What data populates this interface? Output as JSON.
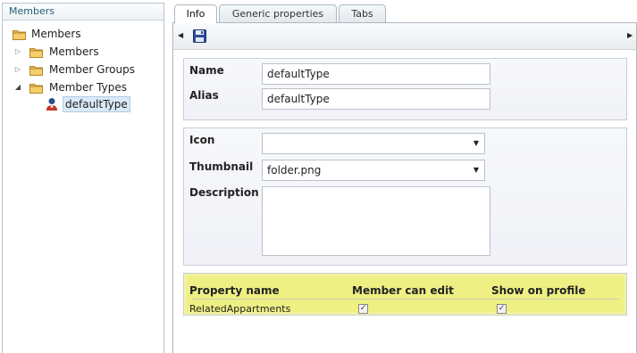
{
  "tree": {
    "header": "Members",
    "nodes": [
      {
        "label": "Members",
        "icon": "folder-icon"
      },
      {
        "label": "Members",
        "icon": "folder-icon",
        "expander": "collapsed"
      },
      {
        "label": "Member Groups",
        "icon": "folder-icon",
        "expander": "collapsed"
      },
      {
        "label": "Member Types",
        "icon": "folder-icon",
        "expander": "expanded"
      },
      {
        "label": "defaultType",
        "icon": "member-type-icon",
        "selected": true
      }
    ]
  },
  "tabs": [
    "Info",
    "Generic properties",
    "Tabs"
  ],
  "active_tab": "Info",
  "form": {
    "name_label": "Name",
    "name_value": "defaultType",
    "alias_label": "Alias",
    "alias_value": "defaultType",
    "icon_label": "Icon",
    "icon_value": "",
    "thumbnail_label": "Thumbnail",
    "thumbnail_value": "folder.png",
    "description_label": "Description",
    "description_value": ""
  },
  "properties": {
    "headers": [
      "Property name",
      "Member can edit",
      "Show on profile"
    ],
    "rows": [
      {
        "name": "RelatedAppartments",
        "member_can_edit": true,
        "show_on_profile": true
      }
    ]
  },
  "colors": {
    "highlight": "#eef084",
    "tree_header_text": "#1e6378",
    "selection": "#dbe9f8"
  }
}
